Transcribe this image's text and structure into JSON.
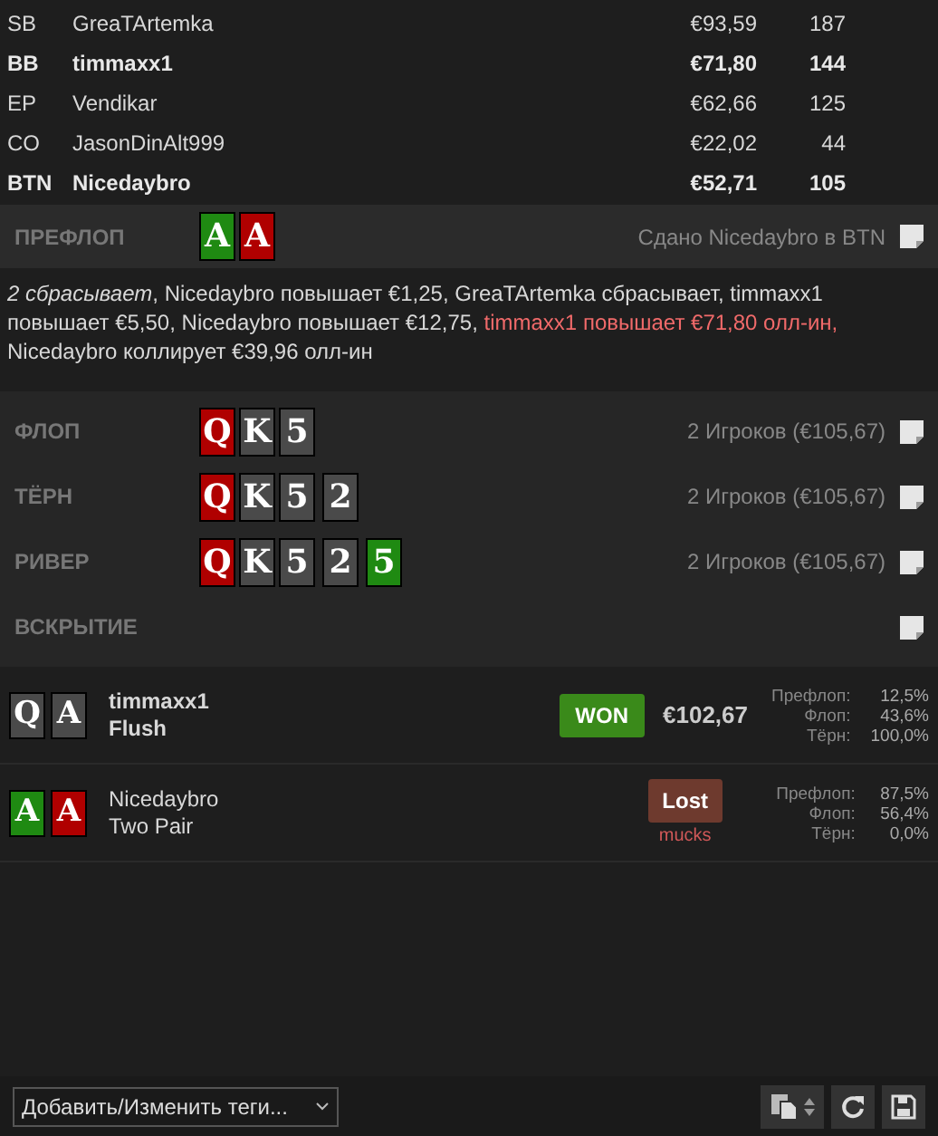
{
  "players": [
    {
      "position": "SB",
      "name": "GreaTArtemka",
      "stack": "€93,59",
      "bb": "187",
      "bold": false
    },
    {
      "position": "BB",
      "name": "timmaxx1",
      "stack": "€71,80",
      "bb": "144",
      "bold": true
    },
    {
      "position": "EP",
      "name": "Vendikar",
      "stack": "€62,66",
      "bb": "125",
      "bold": false
    },
    {
      "position": "CO",
      "name": "JasonDinAlt999",
      "stack": "€22,02",
      "bb": "44",
      "bold": false
    },
    {
      "position": "BTN",
      "name": "Nicedaybro",
      "stack": "€52,71",
      "bb": "105",
      "bold": true
    }
  ],
  "preflop": {
    "label": "ПРЕФЛОП",
    "cards": [
      {
        "rank": "A",
        "color": "#1f8a12"
      },
      {
        "rank": "A",
        "color": "#b00000"
      }
    ],
    "info": "Сдано Nicedaybro в BTN"
  },
  "actions": [
    {
      "text": "*2 сбрасывает*, Nicedaybro повышает €1,25, GreaTArtemka сбрасывает, timmaxx1 повышает €5,50, Nicedaybro повышает €12,75, ",
      "kind": "normal"
    },
    {
      "text": "timmaxx1 повышает €71,80 олл-ин,",
      "kind": "allin"
    },
    {
      "text": " Nicedaybro коллирует €39,96 олл-ин",
      "kind": "normal"
    }
  ],
  "streets": [
    {
      "label": "ФЛОП",
      "cards": [
        {
          "rank": "Q",
          "color": "#b00000"
        },
        {
          "rank": "K",
          "color": "#4a4a4a"
        },
        {
          "rank": "5",
          "color": "#4a4a4a"
        }
      ],
      "info": "2 Игроков (€105,67)"
    },
    {
      "label": "ТЁРН",
      "cards": [
        {
          "rank": "Q",
          "color": "#b00000"
        },
        {
          "rank": "K",
          "color": "#4a4a4a"
        },
        {
          "rank": "5",
          "color": "#4a4a4a"
        },
        {
          "rank": "2",
          "color": "#4a4a4a"
        }
      ],
      "info": "2 Игроков (€105,67)"
    },
    {
      "label": "РИВЕР",
      "cards": [
        {
          "rank": "Q",
          "color": "#b00000"
        },
        {
          "rank": "K",
          "color": "#4a4a4a"
        },
        {
          "rank": "5",
          "color": "#4a4a4a"
        },
        {
          "rank": "2",
          "color": "#4a4a4a"
        },
        {
          "rank": "5",
          "color": "#1f8a12"
        }
      ],
      "info": "2 Игроков (€105,67)"
    },
    {
      "label": "ВСКРЫТИЕ"
    }
  ],
  "showdown": [
    {
      "cards": [
        {
          "rank": "Q",
          "color": "#4a4a4a"
        },
        {
          "rank": "A",
          "color": "#4a4a4a"
        }
      ],
      "name": "timmaxx1",
      "hand": "Flush",
      "bold": true,
      "result": {
        "kind": "won",
        "label": "WON"
      },
      "amount": "€102,67",
      "equity": [
        {
          "label": "Префлоп:",
          "value": "12,5%"
        },
        {
          "label": "Флоп:",
          "value": "43,6%"
        },
        {
          "label": "Тёрн:",
          "value": "100,0%"
        }
      ]
    },
    {
      "cards": [
        {
          "rank": "A",
          "color": "#1f8a12"
        },
        {
          "rank": "A",
          "color": "#b00000"
        }
      ],
      "name": "Nicedaybro",
      "hand": "Two Pair",
      "bold": false,
      "result": {
        "kind": "lost",
        "label": "Lost",
        "note": "mucks"
      },
      "equity": [
        {
          "label": "Префлоп:",
          "value": "87,5%"
        },
        {
          "label": "Флоп:",
          "value": "56,4%"
        },
        {
          "label": "Тёрн:",
          "value": "0,0%"
        }
      ]
    }
  ],
  "tags_dropdown": {
    "value": "Добавить/Изменить теги..."
  }
}
